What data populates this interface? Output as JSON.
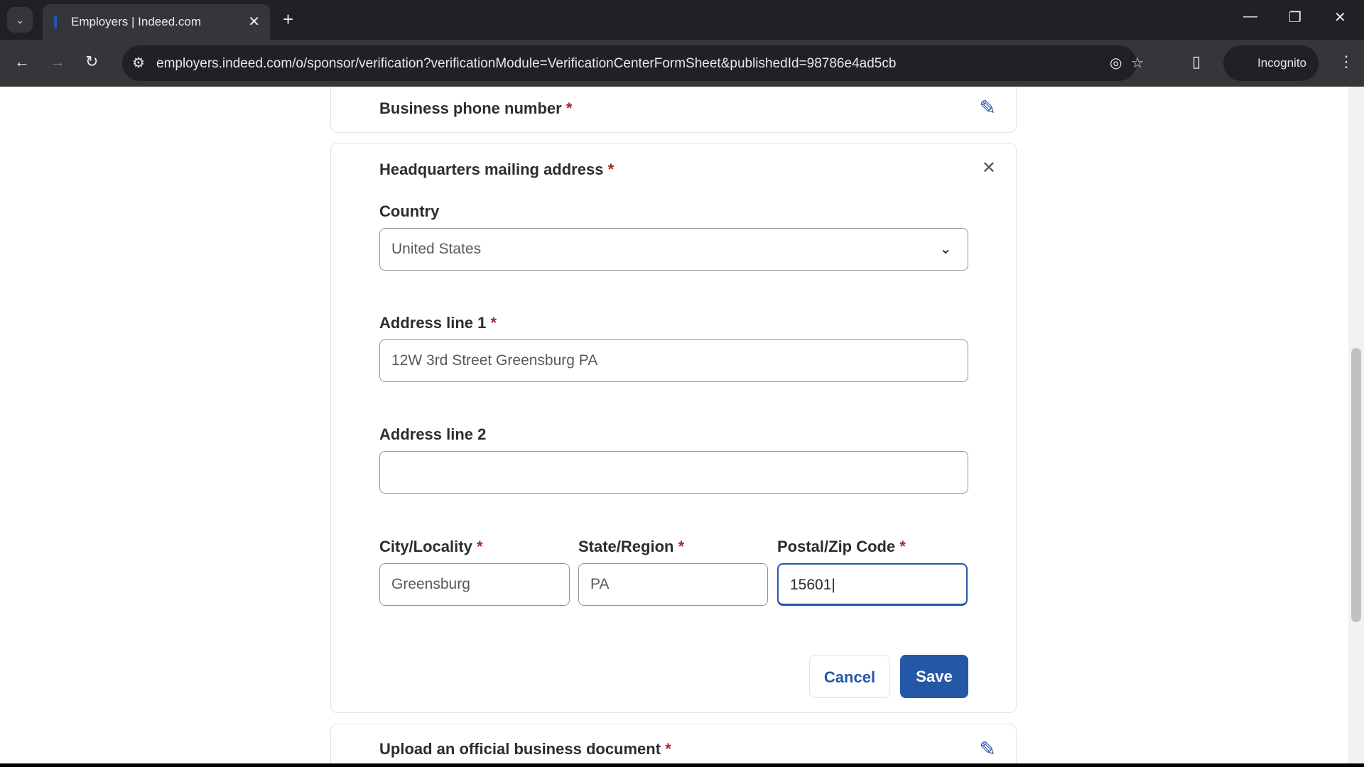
{
  "browser": {
    "tab_title": "Employers | Indeed.com",
    "url": "employers.indeed.com/o/sponsor/verification?verificationModule=VerificationCenterFormSheet&publishedId=98786e4ad5cb",
    "incognito_label": "Incognito"
  },
  "form": {
    "phone_section": {
      "title": "Business phone number",
      "required": "*"
    },
    "address_section": {
      "title": "Headquarters mailing address",
      "required": "*",
      "country_label": "Country",
      "country_value": "United States",
      "address1_label": "Address line 1",
      "address1_value": "12W 3rd Street Greensburg PA",
      "address2_label": "Address line 2",
      "address2_value": "",
      "city_label": "City/Locality",
      "city_value": "Greensburg",
      "state_label": "State/Region",
      "state_value": "PA",
      "postal_label": "Postal/Zip Code",
      "postal_value": "15601",
      "cancel_label": "Cancel",
      "save_label": "Save"
    },
    "upload_section": {
      "title": "Upload an official business document",
      "required": "*"
    }
  },
  "colors": {
    "accent": "#2557a7",
    "required": "#a9252b"
  }
}
